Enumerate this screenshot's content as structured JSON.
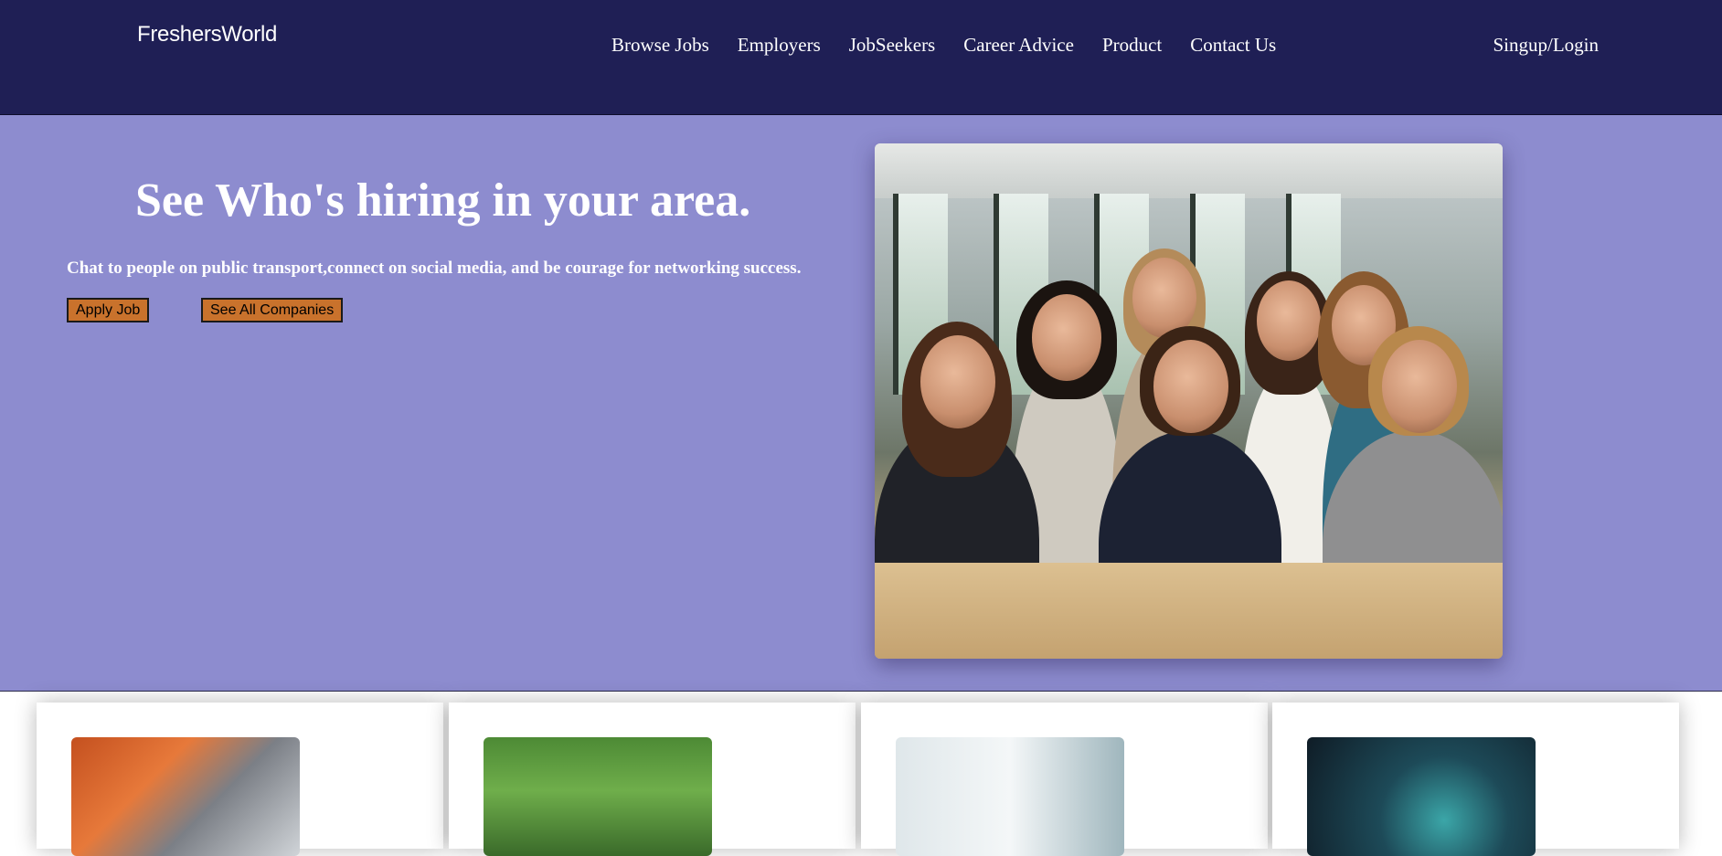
{
  "nav": {
    "brand": "FreshersWorld",
    "links": [
      {
        "label": "Browse Jobs"
      },
      {
        "label": "Employers"
      },
      {
        "label": "JobSeekers"
      },
      {
        "label": "Career Advice"
      },
      {
        "label": "Product"
      },
      {
        "label": "Contact Us"
      }
    ],
    "login": "Singup/Login"
  },
  "hero": {
    "title": "See Who's hiring in your area.",
    "subtitle": "Chat to people on public transport,connect on social media, and be courage for networking success.",
    "apply_button": "Apply Job",
    "companies_button": "See All Companies",
    "image": "team-of-smiling-women-photo"
  },
  "cards": [
    {
      "image": "engineer-with-robot-arm-photo"
    },
    {
      "image": "graduate-student-photo"
    },
    {
      "image": "business-woman-portrait-photo"
    },
    {
      "image": "technology-tablet-photo"
    }
  ],
  "colors": {
    "navbar": "#1f1f55",
    "hero_background": "#8d8ccf",
    "button": "#c9722c",
    "text_light": "#ffffff"
  }
}
